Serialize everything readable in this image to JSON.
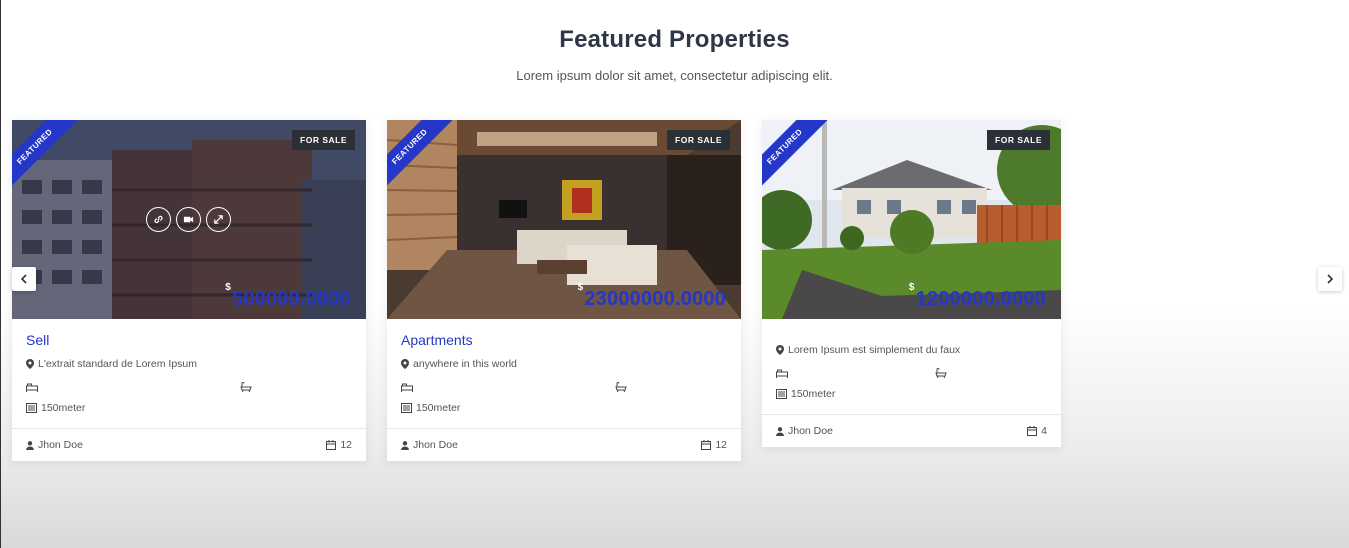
{
  "section": {
    "title": "Featured Properties",
    "subtitle": "Lorem ipsum dolor sit amet, consectetur adipiscing elit."
  },
  "colors": {
    "accent": "#2437c9",
    "badge": "#2b2f36"
  },
  "carousel": {
    "prev_icon": "chevron-left-icon",
    "next_icon": "chevron-right-icon"
  },
  "properties": [
    {
      "ribbon": "FEATURED",
      "status": "FOR SALE",
      "currency": "$",
      "price": "500000.0000",
      "title": "Sell",
      "address": "L'extrait standard de Lorem Ipsum",
      "area": "150meter",
      "agent": "Jhon Doe",
      "date": "12",
      "hover_icons": [
        "link-icon",
        "video-icon",
        "expand-icon"
      ]
    },
    {
      "ribbon": "FEATURED",
      "status": "FOR SALE",
      "currency": "$",
      "price": "23000000.0000",
      "title": "Apartments",
      "address": "anywhere in this world",
      "area": "150meter",
      "agent": "Jhon Doe",
      "date": "12"
    },
    {
      "ribbon": "FEATURED",
      "status": "FOR SALE",
      "currency": "$",
      "price": "1200000.0000",
      "title": "",
      "address": "Lorem Ipsum est simplement du faux",
      "area": "150meter",
      "agent": "Jhon Doe",
      "date": "4"
    }
  ]
}
